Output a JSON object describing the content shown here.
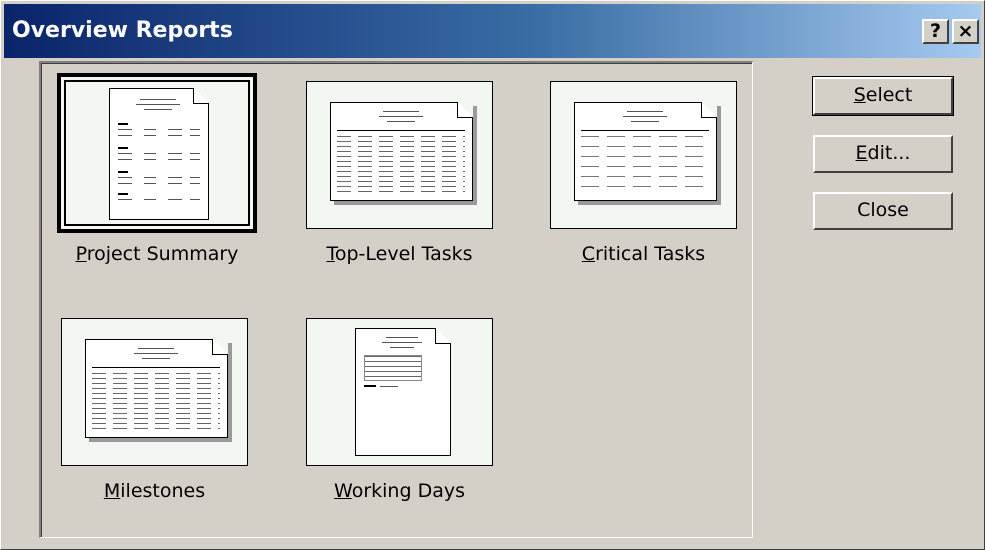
{
  "window": {
    "title": "Overview Reports",
    "help_glyph": "?",
    "close_glyph": "×"
  },
  "reports": [
    {
      "label": "Project Summary",
      "mnemonic": "P",
      "rest": "roject Summary",
      "layout": "summary",
      "selected": true
    },
    {
      "label": "Top-Level Tasks",
      "mnemonic": "T",
      "rest": "op-Level Tasks",
      "layout": "table",
      "selected": false
    },
    {
      "label": "Critical Tasks",
      "mnemonic": "C",
      "rest": "ritical Tasks",
      "layout": "critical",
      "selected": false
    },
    {
      "label": "Milestones",
      "mnemonic": "M",
      "rest": "ilestones",
      "layout": "table",
      "selected": false
    },
    {
      "label": "Working Days",
      "mnemonic": "W",
      "rest": "orking Days",
      "layout": "calendar",
      "selected": false
    }
  ],
  "buttons": {
    "select": {
      "mnemonic": "S",
      "rest": "elect"
    },
    "edit": {
      "mnemonic": "E",
      "rest": "dit..."
    },
    "close": {
      "label": "Close"
    }
  }
}
